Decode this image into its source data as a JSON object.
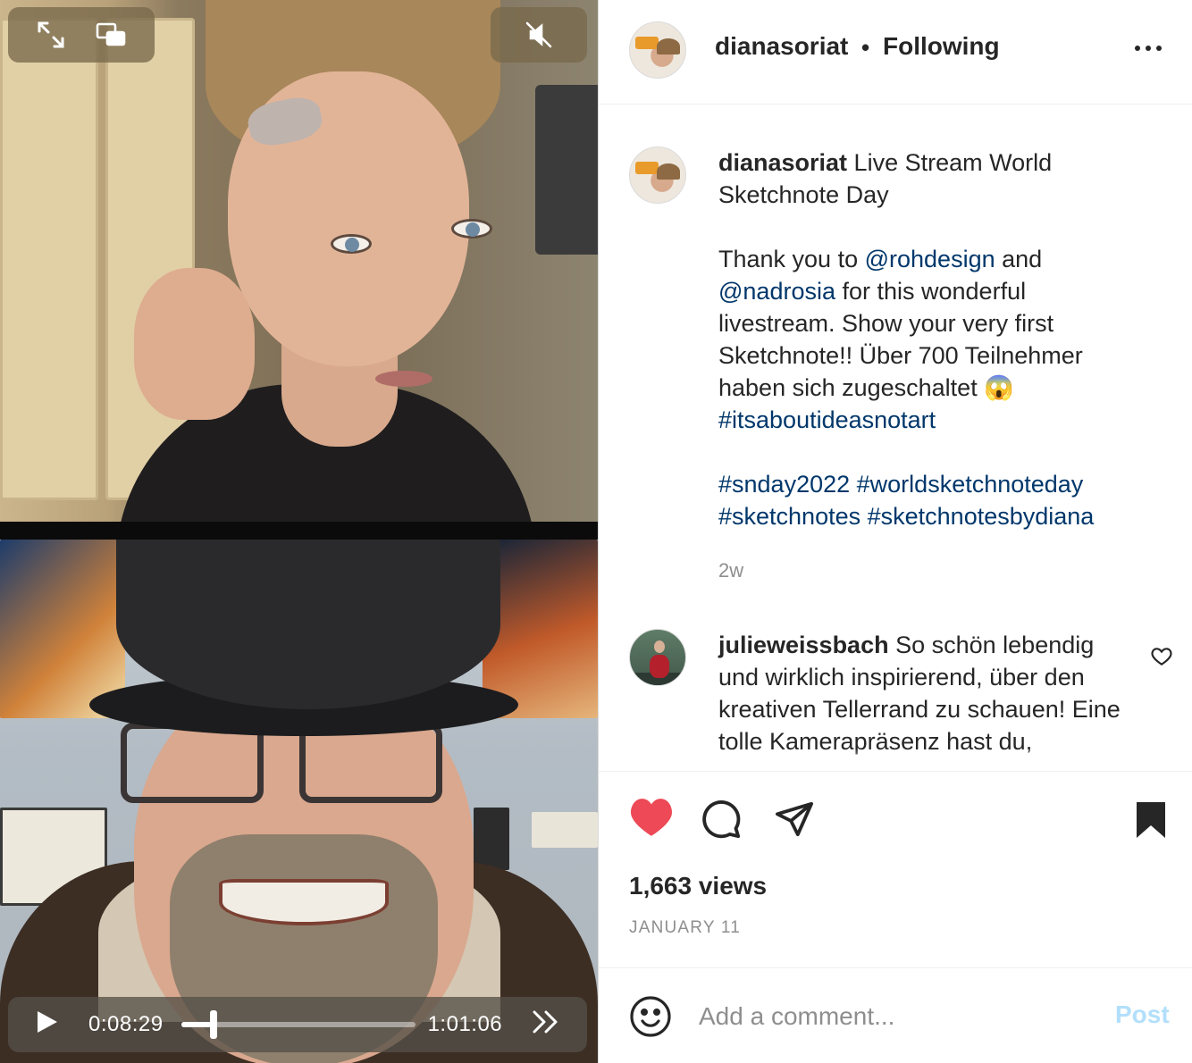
{
  "video": {
    "current_time": "0:08:29",
    "duration": "1:01:06",
    "progress": 0.139,
    "top_controls": {
      "expand_icon": "expand-icon",
      "pip_icon": "picture-in-picture-icon",
      "mute_icon": "muted-speaker-icon"
    }
  },
  "post": {
    "author": "dianasoriat",
    "separator": "•",
    "follow_status": "Following",
    "caption": {
      "username": "dianasoriat",
      "title_text": " Live Stream World\nSketchnote Day",
      "body_1": "\n\nThank you to ",
      "mention_1": "@rohdesign",
      "body_2": " and\n",
      "mention_2": "@nadrosia",
      "body_3": " for this wonderful\nlivestream. Show your very first\nSketchnote!! Über 700 Teilnehmer\nhaben sich zugeschaltet 😱\n",
      "hashtag_1": "#itsaboutideasnotart",
      "spacer": "\n\n",
      "hashtag_2": "#snday2022",
      "space": " ",
      "hashtag_3": "#worldsketchnoteday",
      "newline": "\n",
      "hashtag_4": "#sketchnotes",
      "space2": " ",
      "hashtag_5": "#sketchnotesbydiana"
    },
    "age": "2w",
    "comments": [
      {
        "username": "julieweissbach",
        "text": " So schön lebendig und wirklich inspirierend, über den kreativen Tellerrand zu schauen! Eine tolle Kamerapräsenz hast du,"
      }
    ],
    "liked": true,
    "views": "1,663 views",
    "date": "JANUARY 11"
  },
  "comment_box": {
    "placeholder": "Add a comment...",
    "post_label": "Post"
  },
  "colors": {
    "like": "#ed4956",
    "link": "#00376b",
    "muted_text": "#8e8e8e",
    "post_disabled": "#b2dffc"
  }
}
